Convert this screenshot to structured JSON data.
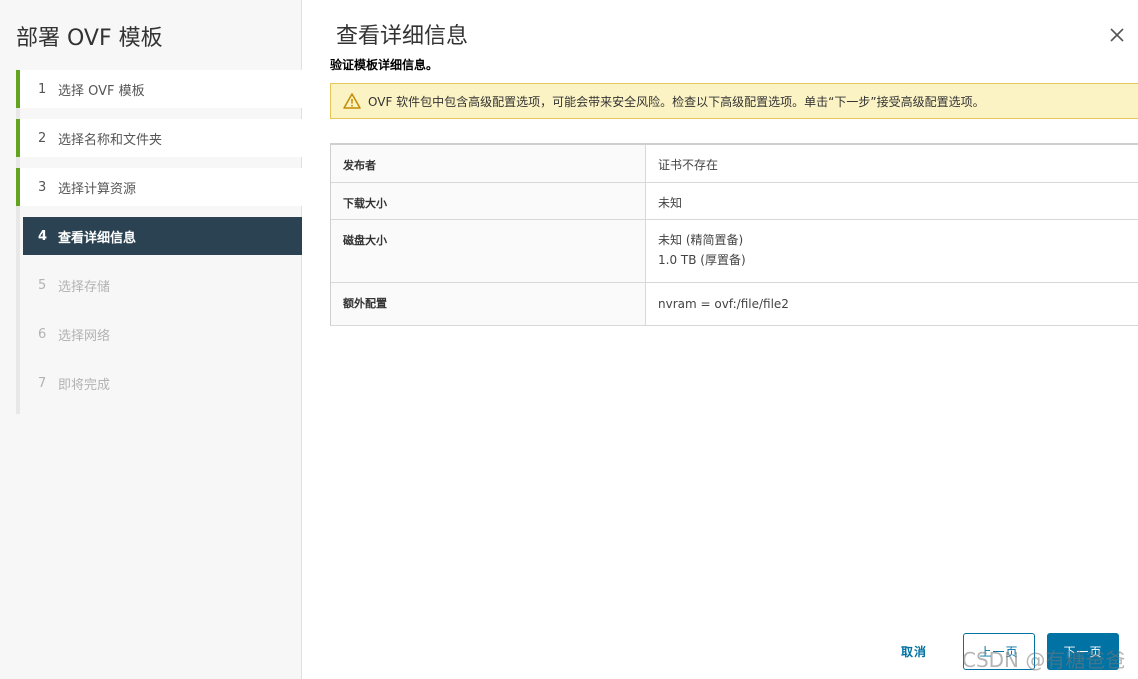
{
  "sidebar": {
    "title": "部署 OVF 模板",
    "steps": [
      {
        "num": "1",
        "label": "选择 OVF 模板",
        "state": "done"
      },
      {
        "num": "2",
        "label": "选择名称和文件夹",
        "state": "done"
      },
      {
        "num": "3",
        "label": "选择计算资源",
        "state": "done"
      },
      {
        "num": "4",
        "label": "查看详细信息",
        "state": "active"
      },
      {
        "num": "5",
        "label": "选择存储",
        "state": "future"
      },
      {
        "num": "6",
        "label": "选择网络",
        "state": "future"
      },
      {
        "num": "7",
        "label": "即将完成",
        "state": "future"
      }
    ]
  },
  "main": {
    "title": "查看详细信息",
    "subtitle": "验证模板详细信息。",
    "warning": {
      "icon": "warning-triangle-icon",
      "text": "OVF 软件包中包含高级配置选项，可能会带来安全风险。检查以下高级配置选项。单击“下一步”接受高级配置选项。"
    },
    "details": [
      {
        "key": "发布者",
        "values": [
          "证书不存在"
        ]
      },
      {
        "key": "下载大小",
        "values": [
          "未知"
        ]
      },
      {
        "key": "磁盘大小",
        "values": [
          "未知 (精简置备)",
          "1.0 TB (厚置备)"
        ]
      },
      {
        "key": "额外配置",
        "values": [
          "nvram = ovf:/file/file2"
        ]
      }
    ]
  },
  "footer": {
    "cancel_label": "取消",
    "back_label": "上一页",
    "next_label": "下一页"
  },
  "watermark": "CSDN @有糖爸爸",
  "colors": {
    "done_accent": "#62a420",
    "active_bg": "#2b4252",
    "primary": "#0072a3",
    "warning_bg": "#fbf3c4",
    "warning_icon": "#c28b00"
  }
}
